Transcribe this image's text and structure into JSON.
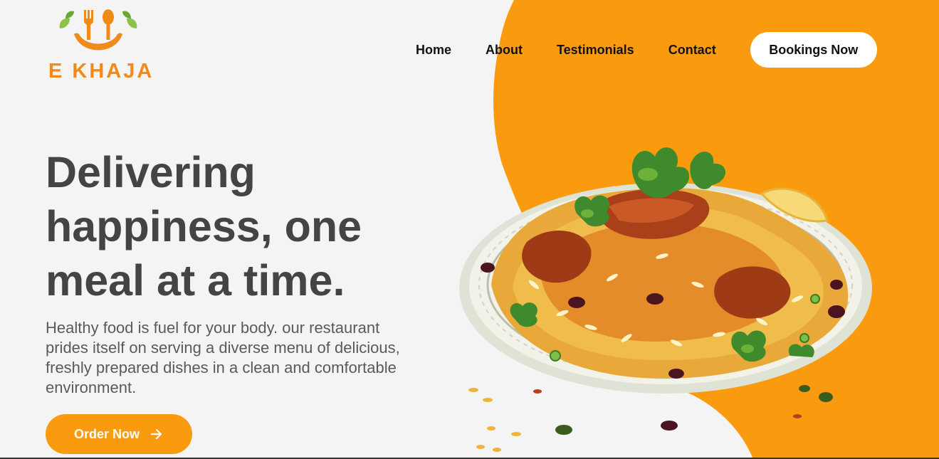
{
  "brand": {
    "name": "E KHAJA",
    "logo_icon": "fork-spoon-smile-logo"
  },
  "nav": {
    "links": [
      {
        "label": "Home"
      },
      {
        "label": "About"
      },
      {
        "label": "Testimonials"
      },
      {
        "label": "Contact"
      }
    ],
    "booking_button": "Bookings Now"
  },
  "hero": {
    "title": "Delivering happiness, one meal at a time.",
    "description": "Healthy food is fuel for your body. our restaurant prides itself on serving a diverse menu of delicious, freshly prepared dishes in a clean and comfortable environment.",
    "cta_label": "Order Now",
    "cta_icon": "arrow-right-icon",
    "image": "biryani-plate-illustration"
  },
  "colors": {
    "accent": "#fa9b0f",
    "background": "#f4f4f4",
    "text_dark": "#444444",
    "logo": "#f28a1a"
  }
}
